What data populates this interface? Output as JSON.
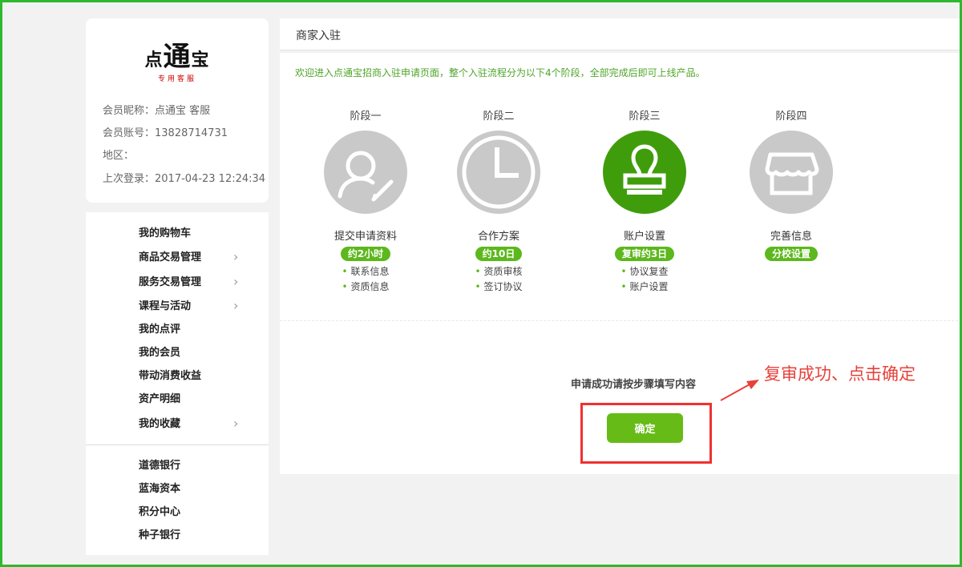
{
  "profile": {
    "logo_main": "点通宝",
    "logo_big": "通",
    "logo_left": "点",
    "logo_right": "宝",
    "logo_sub": "专用客服",
    "nickname": "会员昵称：点通宝 客服",
    "account": "会员账号：13828714731",
    "region": "地区：",
    "last_login": "上次登录：2017-04-23 12:24:34"
  },
  "menu": {
    "group1": [
      {
        "label": "我的购物车",
        "has_arrow": false
      },
      {
        "label": "商品交易管理",
        "has_arrow": true
      },
      {
        "label": "服务交易管理",
        "has_arrow": true
      },
      {
        "label": "课程与活动",
        "has_arrow": true
      },
      {
        "label": "我的点评",
        "has_arrow": false
      },
      {
        "label": "我的会员",
        "has_arrow": false
      },
      {
        "label": "带动消费收益",
        "has_arrow": false
      },
      {
        "label": "资产明细",
        "has_arrow": false
      },
      {
        "label": "我的收藏",
        "has_arrow": true
      }
    ],
    "group2": [
      {
        "label": "道德银行"
      },
      {
        "label": "蓝海资本"
      },
      {
        "label": "积分中心"
      },
      {
        "label": "种子银行"
      }
    ],
    "arrow_glyph": "›"
  },
  "main": {
    "title": "商家入驻",
    "intro": "欢迎进入点通宝招商入驻申请页面，整个入驻流程分为以下4个阶段，全部完成后即可上线产品。",
    "stages": [
      {
        "name": "阶段一",
        "title": "提交申请资料",
        "badge": "约2小时",
        "items": [
          "联系信息",
          "资质信息"
        ],
        "icon": "user-edit-icon",
        "active": false
      },
      {
        "name": "阶段二",
        "title": "合作方案",
        "badge": "约10日",
        "items": [
          "资质审核",
          "签订协议"
        ],
        "icon": "clock-icon",
        "active": false
      },
      {
        "name": "阶段三",
        "title": "账户设置",
        "badge": "复审约3日",
        "items": [
          "协议复查",
          "账户设置"
        ],
        "icon": "stamp-icon",
        "active": true
      },
      {
        "name": "阶段四",
        "title": "完善信息",
        "badge": "分校设置",
        "items": [],
        "icon": "shop-icon",
        "active": false
      }
    ],
    "apply_message": "申请成功请按步骤填写内容",
    "confirm_label": "确定"
  },
  "annotation": {
    "text": "复审成功、点击确定",
    "color": "#e8413a"
  },
  "colors": {
    "accent_green": "#5cb81c",
    "active_circle": "#3f9d0c",
    "inactive_circle": "#c9c9c9",
    "highlight_red": "#f03030",
    "frame_green": "#2eb82e"
  }
}
